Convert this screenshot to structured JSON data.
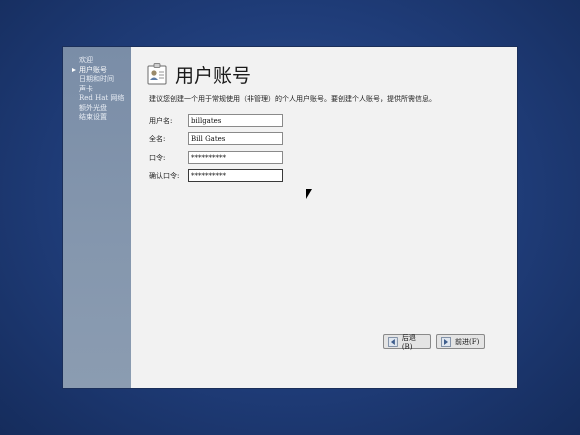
{
  "sidebar": {
    "steps": [
      {
        "label": "欢迎"
      },
      {
        "label": "用户账号"
      },
      {
        "label": "日期和时间"
      },
      {
        "label": "声卡"
      },
      {
        "label": "Red Hat 网络"
      },
      {
        "label": "额外光盘"
      },
      {
        "label": "结束设置"
      }
    ]
  },
  "main": {
    "title": "用户账号",
    "description": "建议您创建一个用于常规使用（非管理）的个人用户账号。要创建个人账号，提供所需信息。",
    "fields": {
      "username": {
        "label": "用户名:",
        "value": "billgates"
      },
      "fullname": {
        "label": "全名:",
        "value": "Bill Gates"
      },
      "password": {
        "label": "口令:",
        "value": "**********"
      },
      "confirm": {
        "label": "确认口令:",
        "value": "**********"
      }
    }
  },
  "buttons": {
    "back_label": "后退(B)",
    "next_label": "前进(F)"
  },
  "icons": {
    "title": "user-badge-icon",
    "back": "arrow-left-icon",
    "next": "arrow-right-icon"
  }
}
